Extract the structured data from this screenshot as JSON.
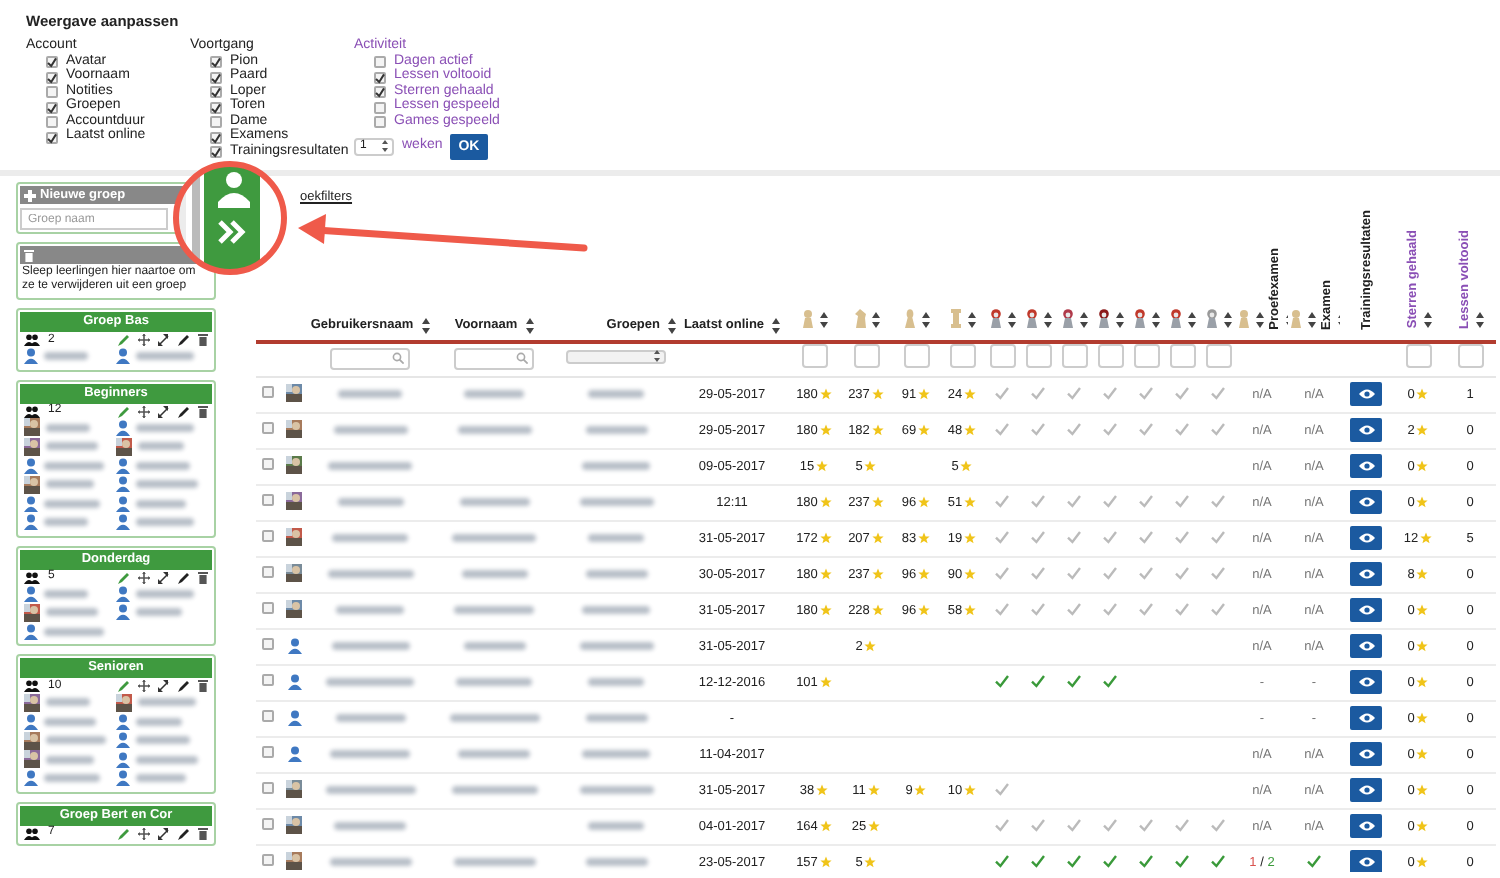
{
  "options": {
    "title": "Weergave aanpassen",
    "groups": [
      {
        "label": "Account",
        "kind": "plain",
        "items": [
          {
            "label": "Avatar",
            "checked": true
          },
          {
            "label": "Voornaam",
            "checked": true
          },
          {
            "label": "Notities",
            "checked": false
          },
          {
            "label": "Groepen",
            "checked": true
          },
          {
            "label": "Accountduur",
            "checked": false
          },
          {
            "label": "Laatst online",
            "checked": true
          }
        ]
      },
      {
        "label": "Voortgang",
        "kind": "plain",
        "items": [
          {
            "label": "Pion",
            "checked": true
          },
          {
            "label": "Paard",
            "checked": true
          },
          {
            "label": "Loper",
            "checked": true
          },
          {
            "label": "Toren",
            "checked": true
          },
          {
            "label": "Dame",
            "checked": false
          },
          {
            "label": "Examens",
            "checked": true
          },
          {
            "label": "Trainingsresultaten",
            "checked": true
          }
        ]
      },
      {
        "label": "Activiteit",
        "kind": "activity",
        "items": [
          {
            "label": "Dagen actief",
            "checked": false
          },
          {
            "label": "Lessen voltooid",
            "checked": true
          },
          {
            "label": "Sterren gehaald",
            "checked": true
          },
          {
            "label": "Lessen gespeeld",
            "checked": false
          },
          {
            "label": "Games gespeeld",
            "checked": false
          }
        ]
      }
    ],
    "period": {
      "value": "1",
      "unit": "weken",
      "button": "OK"
    }
  },
  "sidebar": {
    "new_group": {
      "title": "Nieuwe groep",
      "placeholder": "Groep naam"
    },
    "trash": {
      "text": "Sleep leerlingen hier naartoe om ze te verwijderen uit een groep"
    },
    "groups": [
      {
        "name": "Groep Bas",
        "count": "2",
        "members": [
          {
            "photo": false
          },
          {
            "photo": false
          }
        ]
      },
      {
        "name": "Beginners",
        "count": "12",
        "members": [
          {
            "photo": true
          },
          {
            "photo": false
          },
          {
            "photo": true
          },
          {
            "photo": true
          },
          {
            "photo": false
          },
          {
            "photo": false
          },
          {
            "photo": true
          },
          {
            "photo": false
          },
          {
            "photo": false
          },
          {
            "photo": false
          },
          {
            "photo": false
          },
          {
            "photo": false
          }
        ]
      },
      {
        "name": "Donderdag",
        "count": "5",
        "members": [
          {
            "photo": false
          },
          {
            "photo": false
          },
          {
            "photo": true
          },
          {
            "photo": false
          },
          {
            "photo": false
          }
        ]
      },
      {
        "name": "Senioren",
        "count": "10",
        "members": [
          {
            "photo": true
          },
          {
            "photo": true
          },
          {
            "photo": false
          },
          {
            "photo": false
          },
          {
            "photo": true
          },
          {
            "photo": false
          },
          {
            "photo": true
          },
          {
            "photo": false
          },
          {
            "photo": false
          },
          {
            "photo": false
          }
        ]
      },
      {
        "name": "Groep Bert en Cor",
        "count": "7"
      }
    ]
  },
  "table": {
    "filter_link": "oekfilters",
    "headers": {
      "username": "Gebruikersnaam",
      "first_name": "Voornaam",
      "groups": "Groepen",
      "last_online": "Laatst online",
      "proefexamen": "Proefexamen",
      "examen": "Examen",
      "training": "Trainingsresultaten",
      "stars": "Sterren gehaald",
      "lessons": "Lessen voltooid"
    },
    "rows": [
      {
        "checked": false,
        "photo": true,
        "first_name_visible": true,
        "last_online": "29-05-2017",
        "stars": {
          "pion": "180",
          "paard": "237",
          "loper": "91",
          "toren": "24"
        },
        "checks": [
          {
            "passed": false
          },
          {
            "passed": false
          },
          {
            "passed": false
          },
          {
            "passed": false
          },
          {
            "passed": false
          },
          {
            "passed": false
          },
          {
            "passed": false
          }
        ],
        "proefexamen": {
          "kind": "text",
          "text": "n/A"
        },
        "examen": {
          "kind": "text",
          "text": "n/A"
        },
        "stars_earned": "0",
        "lessons": "1"
      },
      {
        "checked": false,
        "photo": true,
        "first_name_visible": true,
        "last_online": "29-05-2017",
        "stars": {
          "pion": "180",
          "paard": "182",
          "loper": "69",
          "toren": "48"
        },
        "checks": [
          {
            "passed": false
          },
          {
            "passed": false
          },
          {
            "passed": false
          },
          {
            "passed": false
          },
          {
            "passed": false
          },
          {
            "passed": false
          },
          {
            "passed": false
          }
        ],
        "proefexamen": {
          "kind": "text",
          "text": "n/A"
        },
        "examen": {
          "kind": "text",
          "text": "n/A"
        },
        "stars_earned": "2",
        "lessons": "0"
      },
      {
        "checked": false,
        "photo": true,
        "first_name_visible": false,
        "last_online": "09-05-2017",
        "stars": {
          "pion": "15",
          "paard": "5",
          "toren": "5"
        },
        "proefexamen": {
          "kind": "text",
          "text": "n/A"
        },
        "examen": {
          "kind": "text",
          "text": "n/A"
        },
        "stars_earned": "0",
        "lessons": "0"
      },
      {
        "checked": false,
        "photo": true,
        "first_name_visible": true,
        "last_online": "12:11",
        "stars": {
          "pion": "180",
          "paard": "237",
          "loper": "96",
          "toren": "51"
        },
        "checks": [
          {
            "passed": false
          },
          {
            "passed": false
          },
          {
            "passed": false
          },
          {
            "passed": false
          },
          {
            "passed": false
          },
          {
            "passed": false
          },
          {
            "passed": false
          }
        ],
        "proefexamen": {
          "kind": "text",
          "text": "n/A"
        },
        "examen": {
          "kind": "text",
          "text": "n/A"
        },
        "stars_earned": "0",
        "lessons": "0"
      },
      {
        "checked": false,
        "photo": true,
        "first_name_visible": true,
        "last_online": "31-05-2017",
        "stars": {
          "pion": "172",
          "paard": "207",
          "loper": "83",
          "toren": "19"
        },
        "checks": [
          {
            "passed": false
          },
          {
            "passed": false
          },
          {
            "passed": false
          },
          {
            "passed": false
          },
          {
            "passed": false
          },
          {
            "passed": false
          },
          {
            "passed": false
          }
        ],
        "proefexamen": {
          "kind": "text",
          "text": "n/A"
        },
        "examen": {
          "kind": "text",
          "text": "n/A"
        },
        "stars_earned": "12",
        "lessons": "5"
      },
      {
        "checked": false,
        "photo": true,
        "first_name_visible": true,
        "last_online": "30-05-2017",
        "stars": {
          "pion": "180",
          "paard": "237",
          "loper": "96",
          "toren": "90"
        },
        "checks": [
          {
            "passed": false
          },
          {
            "passed": false
          },
          {
            "passed": false
          },
          {
            "passed": false
          },
          {
            "passed": false
          },
          {
            "passed": false
          },
          {
            "passed": false
          }
        ],
        "proefexamen": {
          "kind": "text",
          "text": "n/A"
        },
        "examen": {
          "kind": "text",
          "text": "n/A"
        },
        "stars_earned": "8",
        "lessons": "0"
      },
      {
        "checked": false,
        "photo": true,
        "first_name_visible": true,
        "last_online": "31-05-2017",
        "stars": {
          "pion": "180",
          "paard": "228",
          "loper": "96",
          "toren": "58"
        },
        "checks": [
          {
            "passed": false
          },
          {
            "passed": false
          },
          {
            "passed": false
          },
          {
            "passed": false
          },
          {
            "passed": false
          },
          {
            "passed": false
          },
          {
            "passed": false
          }
        ],
        "proefexamen": {
          "kind": "text",
          "text": "n/A"
        },
        "examen": {
          "kind": "text",
          "text": "n/A"
        },
        "stars_earned": "0",
        "lessons": "0"
      },
      {
        "checked": false,
        "photo": false,
        "first_name_visible": true,
        "last_online": "31-05-2017",
        "stars": {
          "paard": "2"
        },
        "proefexamen": {
          "kind": "text",
          "text": "n/A"
        },
        "examen": {
          "kind": "text",
          "text": "n/A"
        },
        "stars_earned": "0",
        "lessons": "0"
      },
      {
        "checked": false,
        "photo": false,
        "first_name_visible": true,
        "last_online": "12-12-2016",
        "stars": {
          "pion": "101"
        },
        "checks": [
          {
            "passed": true
          },
          {
            "passed": true
          },
          {
            "passed": true
          },
          {
            "passed": true
          }
        ],
        "proefexamen": {
          "kind": "text",
          "text": "-"
        },
        "examen": {
          "kind": "text",
          "text": "-"
        },
        "stars_earned": "0",
        "lessons": "0"
      },
      {
        "checked": false,
        "photo": false,
        "first_name_visible": true,
        "last_online": "-",
        "proefexamen": {
          "kind": "text",
          "text": "-"
        },
        "examen": {
          "kind": "text",
          "text": "-"
        },
        "stars_earned": "0",
        "lessons": "0"
      },
      {
        "checked": false,
        "photo": false,
        "first_name_visible": true,
        "last_online": "11-04-2017",
        "proefexamen": {
          "kind": "text",
          "text": "n/A"
        },
        "examen": {
          "kind": "text",
          "text": "n/A"
        },
        "stars_earned": "0",
        "lessons": "0"
      },
      {
        "checked": false,
        "photo": true,
        "first_name_visible": true,
        "last_online": "31-05-2017",
        "stars": {
          "pion": "38",
          "paard": "11",
          "loper": "9",
          "toren": "10"
        },
        "checks": [
          {
            "passed": false
          }
        ],
        "proefexamen": {
          "kind": "text",
          "text": "n/A"
        },
        "examen": {
          "kind": "text",
          "text": "n/A"
        },
        "stars_earned": "0",
        "lessons": "0"
      },
      {
        "checked": false,
        "photo": true,
        "first_name_visible": false,
        "last_online": "04-01-2017",
        "stars": {
          "pion": "164",
          "paard": "25"
        },
        "checks": [
          {
            "passed": false
          },
          {
            "passed": false
          },
          {
            "passed": false
          },
          {
            "passed": false
          },
          {
            "passed": false
          },
          {
            "passed": false
          },
          {
            "passed": false
          }
        ],
        "proefexamen": {
          "kind": "text",
          "text": "n/A"
        },
        "examen": {
          "kind": "text",
          "text": "n/A"
        },
        "stars_earned": "0",
        "lessons": "0"
      },
      {
        "checked": false,
        "photo": true,
        "first_name_visible": true,
        "last_online": "23-05-2017",
        "stars": {
          "pion": "157",
          "paard": "5"
        },
        "checks": [
          {
            "passed": true
          },
          {
            "passed": true
          },
          {
            "passed": true
          },
          {
            "passed": true
          },
          {
            "passed": true
          },
          {
            "passed": true
          },
          {
            "passed": true
          }
        ],
        "proefexamen": {
          "kind": "score",
          "passed": "1",
          "separator": "/",
          "total": "2"
        },
        "examen": {
          "kind": "check"
        },
        "stars_earned": "0",
        "lessons": "0"
      }
    ]
  }
}
